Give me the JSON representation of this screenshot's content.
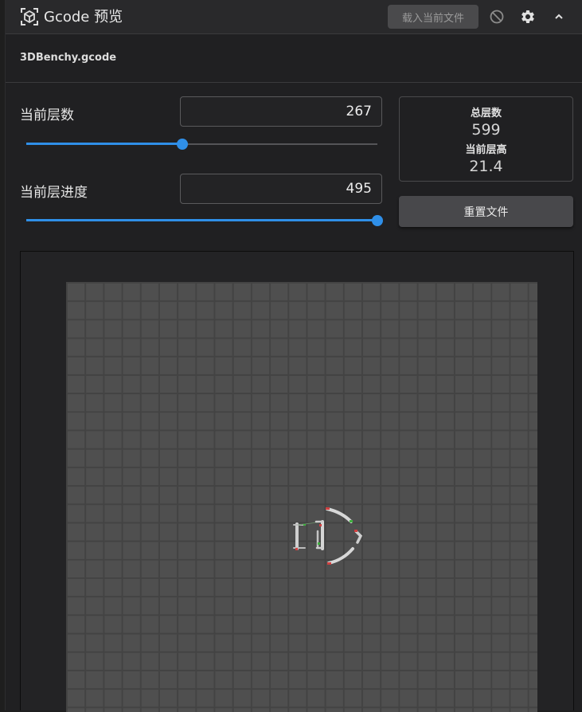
{
  "header": {
    "title": "Gcode 预览",
    "load_button": "载入当前文件",
    "icons": [
      "cube-logo-icon",
      "disable-icon",
      "gear-icon",
      "chevron-up-icon"
    ]
  },
  "file": {
    "name": "3DBenchy.gcode"
  },
  "layer": {
    "label": "当前层数",
    "value": "267",
    "slider_fraction": 0.445
  },
  "progress": {
    "label": "当前层进度",
    "value": "495",
    "slider_fraction": 1.0
  },
  "stats": {
    "total_layers_label": "总层数",
    "total_layers": "599",
    "layer_height_label": "当前层高",
    "layer_height": "21.4"
  },
  "reset_button": "重置文件",
  "colors": {
    "accent": "#2f8fe8",
    "background": "#202022",
    "grid": "#4f4f4f"
  }
}
